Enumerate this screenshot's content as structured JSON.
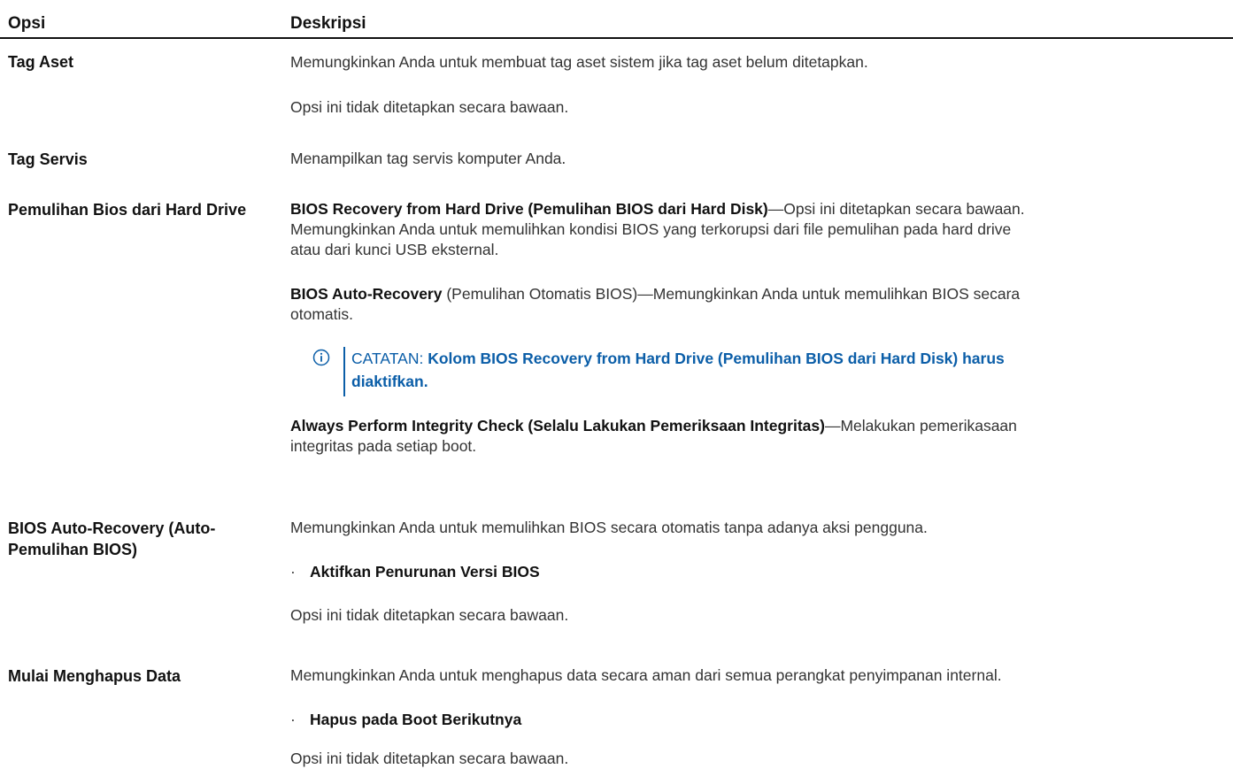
{
  "header": {
    "col1": "Opsi",
    "col2": "Deskripsi"
  },
  "rows": {
    "tag_aset": {
      "label": "Tag Aset",
      "p1": "Memungkinkan Anda untuk membuat tag aset sistem jika tag aset belum ditetapkan.",
      "p2": "Opsi ini tidak ditetapkan secara bawaan."
    },
    "tag_servis": {
      "label": "Tag Servis",
      "p1": "Menampilkan tag servis komputer Anda."
    },
    "pemulihan": {
      "label": "Pemulihan Bios dari Hard Drive",
      "p1_bold": "BIOS Recovery from Hard Drive (Pemulihan BIOS dari Hard Disk)",
      "p1_rest": "—Opsi ini ditetapkan secara bawaan.",
      "p1_line2": "Memungkinkan Anda untuk memulihkan kondisi BIOS yang terkorupsi dari file pemulihan pada hard drive",
      "p1_line3": "atau dari kunci USB eksternal.",
      "p2_bold": "BIOS Auto-Recovery",
      "p2_rest": " (Pemulihan Otomatis BIOS)—Memungkinkan Anda untuk memulihkan BIOS secara",
      "p2_line2": "otomatis.",
      "note_prefix": "CATATAN: ",
      "note_line1": "Kolom BIOS Recovery from Hard Drive (Pemulihan BIOS dari Hard Disk) harus",
      "note_line2": "diaktifkan.",
      "note_icon": "info-circle-icon",
      "p3_bold": "Always Perform Integrity Check (Selalu Lakukan Pemeriksaan Integritas)",
      "p3_rest": "—Melakukan pemerikasaan",
      "p3_line2": "integritas pada setiap boot."
    },
    "auto_recovery": {
      "label": "BIOS Auto-Recovery (Auto-Pemulihan BIOS)",
      "p1": "Memungkinkan Anda untuk memulihkan BIOS secara otomatis tanpa adanya aksi pengguna.",
      "bullet": "Aktifkan Penurunan Versi BIOS",
      "p2": "Opsi ini tidak ditetapkan secara bawaan."
    },
    "hapus_data": {
      "label": "Mulai Menghapus Data",
      "p1": "Memungkinkan Anda untuk menghapus data secara aman dari semua perangkat penyimpanan internal.",
      "bullet": "Hapus pada Boot Berikutnya",
      "p2": "Opsi ini tidak ditetapkan secara bawaan."
    }
  },
  "colors": {
    "note_accent": "#0b5ea8",
    "text": "#333333",
    "heading": "#111111"
  }
}
